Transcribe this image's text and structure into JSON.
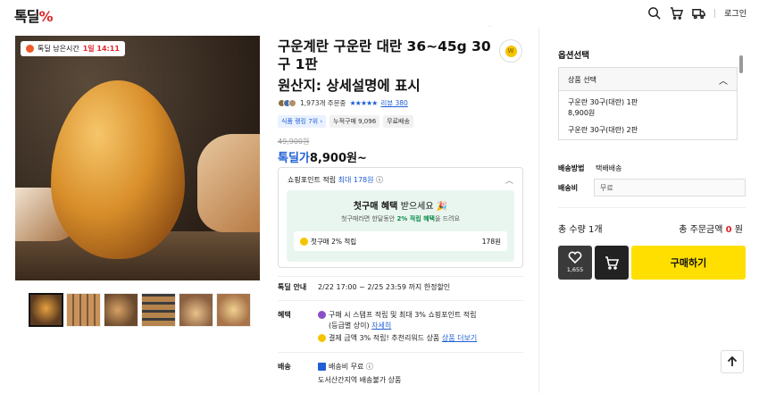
{
  "header": {
    "logo_text": "톡딜",
    "logo_mark": "%",
    "login": "로그인",
    "icons": [
      "search-icon",
      "cart-icon",
      "delivery-truck-icon"
    ]
  },
  "gallery": {
    "timer_label": "톡딜 남은시간",
    "timer_value": "1일 14:11",
    "thumb_count": 6
  },
  "product": {
    "title": "구운계란 구운란 대란 36~45g 30구 1판",
    "origin": "원산지: 상세설명에 표시",
    "order_count": "1,973개 주문중",
    "stars": "★★★★★",
    "review": "리뷰 380",
    "tags": [
      "식품 랭킹 7위 ›",
      "누적구매 9,096",
      "무료배송"
    ],
    "original_price": "49,900원",
    "price_label": "톡딜가",
    "price": "8,900원~"
  },
  "points": {
    "head": "쇼핑포인트 적립",
    "head_max": "최대 178원",
    "benefit_title": "첫구매 혜택",
    "benefit_title_rest": "받으세요 🎉",
    "benefit_sub_a": "첫구매라면 한달동안",
    "benefit_sub_b": "2% 적립 혜택",
    "benefit_sub_c": "을 드려요",
    "row_label": "첫구매 2% 적립",
    "row_value": "178원"
  },
  "info": {
    "deal_k": "톡딜 안내",
    "deal_v": "2/22 17:00 ~ 2/25 23:59 까지 한정할인",
    "benefit_k": "혜택",
    "benefit_v1": "구매 시 스탬프 적립 및 최대 3% 쇼핑포인트 적립",
    "benefit_v1b": "(등급별 상이)",
    "benefit_v1_link": "자세히",
    "benefit_v2": "결제 금액 3% 적립! 추천리워드 상품",
    "benefit_v2_link": "상품 더보기",
    "ship_k": "배송",
    "ship_v1": "배송비 무료",
    "ship_v2": "도서산간지역 배송불가 상품"
  },
  "side": {
    "opt_title": "옵션선택",
    "select_label": "상품 선택",
    "options": [
      {
        "name": "구운란 30구(대란) 1판",
        "price": "8,900원"
      },
      {
        "name": "구운란 30구(대란) 2판",
        "price": ""
      }
    ],
    "pay_k": "배송방법",
    "pay_v": "택배배송",
    "memo_k": "배송비",
    "memo_v": "무료",
    "qty": "총 수량 1개",
    "total_label": "총 주문금액",
    "total_value": "0",
    "total_unit": "원",
    "likes": "1,655",
    "buy": "구매하기"
  }
}
